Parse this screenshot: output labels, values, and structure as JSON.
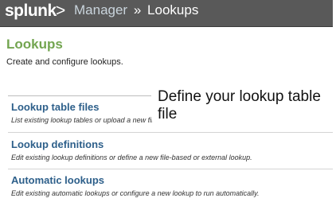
{
  "topbar": {
    "logo": "splunk",
    "logo_chevron": ">",
    "breadcrumb": {
      "manager": "Manager",
      "separator": "»",
      "current": "Lookups"
    }
  },
  "page": {
    "title": "Lookups",
    "subtitle": "Create and configure lookups."
  },
  "entries": [
    {
      "title": "Lookup table files",
      "description": "List existing lookup tables or upload a new file."
    },
    {
      "title": "Lookup definitions",
      "description": "Edit existing lookup definitions or define a new file-based or external lookup."
    },
    {
      "title": "Automatic lookups",
      "description": "Edit existing automatic lookups or configure a new lookup to run automatically."
    }
  ],
  "callout": {
    "text": "Define your lookup table file"
  },
  "colors": {
    "topbar_bg": "#595959",
    "title_green": "#73a550",
    "link_blue": "#2d5f8a"
  }
}
